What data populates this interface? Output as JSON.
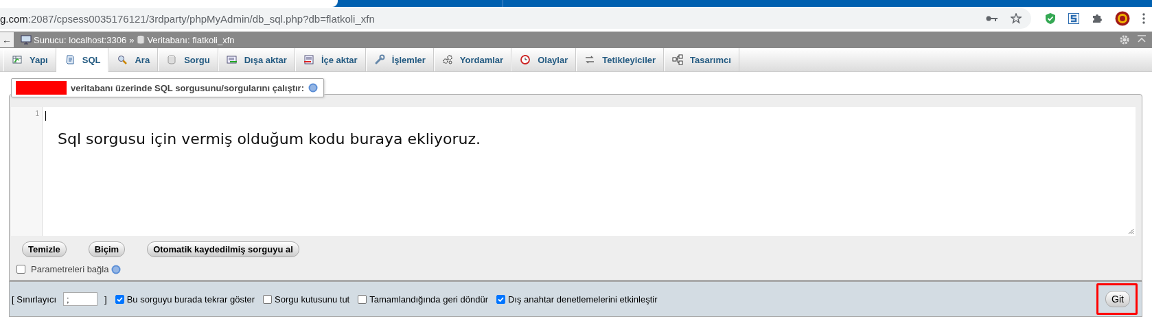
{
  "browser": {
    "url_host": "g.com",
    "url_rest": ":2087/cpsess0035176121/3rdparty/phpMyAdmin/db_sql.php?db=flatkoli_xfn"
  },
  "breadcrumb": {
    "back": "←",
    "server": "Sunucu: localhost:3306",
    "separator": "»",
    "database": "Veritabanı: flatkoli_xfn"
  },
  "tabs": [
    {
      "label": "Yapı",
      "selected": false
    },
    {
      "label": "SQL",
      "selected": true
    },
    {
      "label": "Ara",
      "selected": false
    },
    {
      "label": "Sorgu",
      "selected": false
    },
    {
      "label": "Dışa aktar",
      "selected": false
    },
    {
      "label": "İçe aktar",
      "selected": false
    },
    {
      "label": "İşlemler",
      "selected": false
    },
    {
      "label": "Yordamlar",
      "selected": false
    },
    {
      "label": "Olaylar",
      "selected": false
    },
    {
      "label": "Tetikleyiciler",
      "selected": false
    },
    {
      "label": "Tasarımcı",
      "selected": false
    }
  ],
  "query_box": {
    "legend": "veritabanı üzerinde SQL sorgusunu/sorgularını çalıştır:",
    "line_number": "1",
    "overlay_note": "Sql sorgusu için vermiş olduğum kodu buraya ekliyoruz.",
    "buttons": [
      "Temizle",
      "Biçim",
      "Otomatik kaydedilmiş sorguyu al"
    ],
    "bind_parameters": {
      "label": "Parametreleri bağla",
      "checked": false
    }
  },
  "footer": {
    "delimiter_label_open": "[ Sınırlayıcı",
    "delimiter_value": ";",
    "delimiter_label_close": "]",
    "options": [
      {
        "label": "Bu sorguyu burada tekrar göster",
        "checked": true
      },
      {
        "label": "Sorgu kutusunu tut",
        "checked": false
      },
      {
        "label": "Tamamlandığında geri döndür",
        "checked": false
      },
      {
        "label": "Dış anahtar denetlemelerini etkinleştir",
        "checked": true
      }
    ],
    "submit": "Git"
  }
}
